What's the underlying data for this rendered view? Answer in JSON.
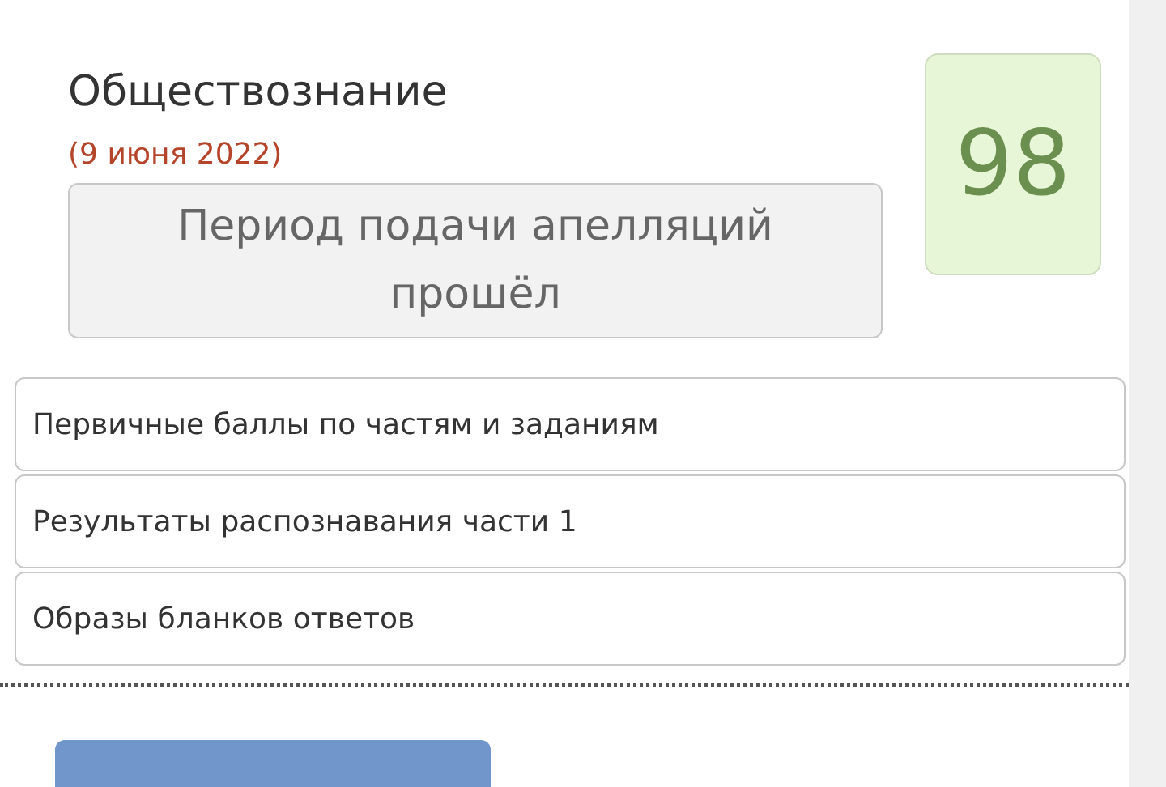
{
  "exam": {
    "subject": "Обществознание",
    "date": "(9 июня 2022)",
    "status": "Период подачи апелляций прошёл",
    "score": "98"
  },
  "details": [
    {
      "label": "Первичные баллы по частям и заданиям"
    },
    {
      "label": "Результаты распознавания части 1"
    },
    {
      "label": "Образы бланков ответов"
    }
  ],
  "bottom_button": {
    "kind": "primary"
  }
}
